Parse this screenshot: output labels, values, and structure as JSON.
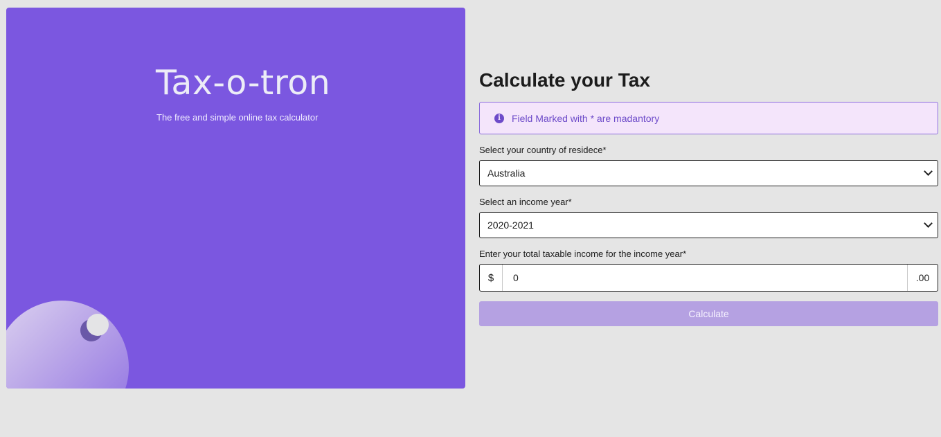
{
  "hero": {
    "title": "Tax-o-tron",
    "subtitle": "The free and simple online tax calculator",
    "background_color": "#7b57e0"
  },
  "form": {
    "title": "Calculate your Tax",
    "notice": {
      "icon": "info-icon",
      "text": "Field Marked with * are madantory"
    },
    "country": {
      "label": "Select your country of residece*",
      "value": "Australia",
      "icon": "chevron-down-icon"
    },
    "year": {
      "label": "Select an income year*",
      "value": "2020-2021",
      "icon": "chevron-down-icon"
    },
    "income": {
      "label": "Enter your total taxable income for the income year*",
      "prefix": "$",
      "value": "0",
      "suffix": ".00"
    },
    "calculate_label": "Calculate",
    "accent_color": "#7b57e0"
  }
}
